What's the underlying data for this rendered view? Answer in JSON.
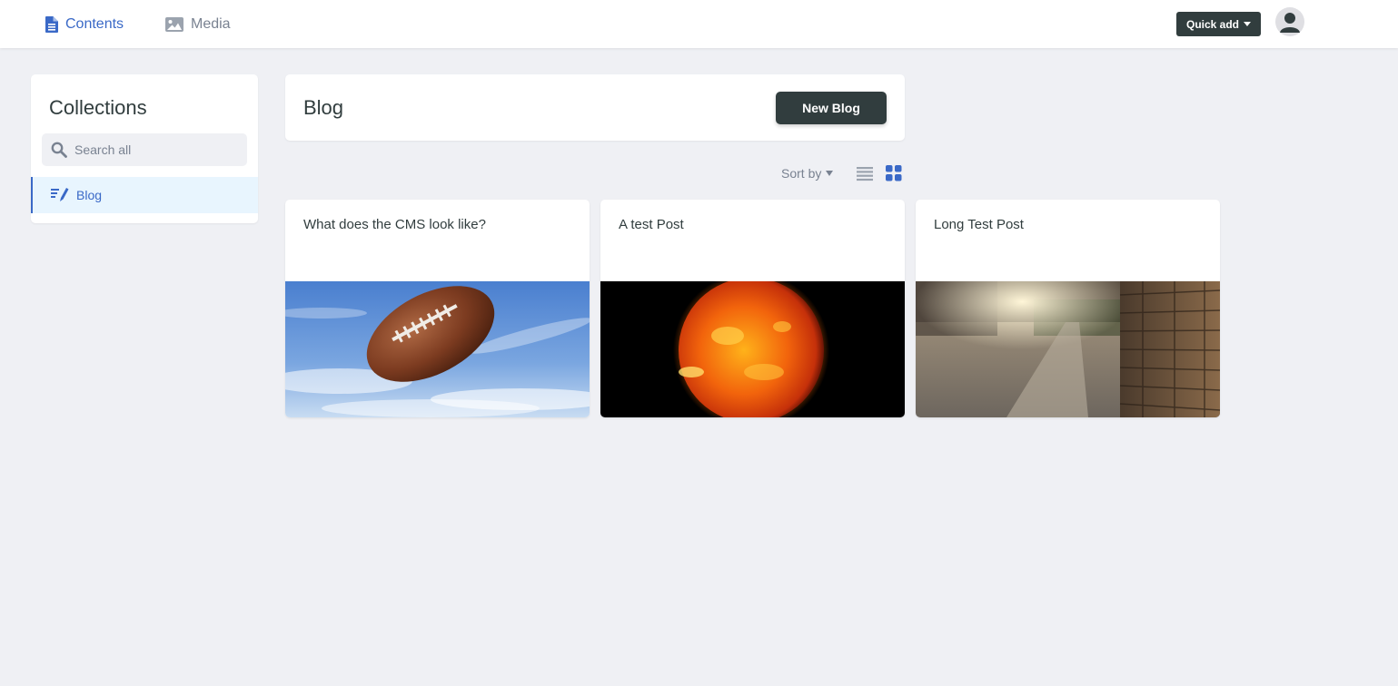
{
  "nav": {
    "contents_label": "Contents",
    "media_label": "Media",
    "quick_add_label": "Quick add"
  },
  "sidebar": {
    "title": "Collections",
    "search_placeholder": "Search all",
    "items": [
      {
        "label": "Blog",
        "icon": "pencil-list-icon",
        "active": true
      }
    ]
  },
  "collection": {
    "title": "Blog",
    "new_button_label": "New Blog",
    "sort_label": "Sort by",
    "view_mode": "grid"
  },
  "entries": [
    {
      "title": "What does the CMS look like?",
      "image": "american-football-in-sky"
    },
    {
      "title": "A test Post",
      "image": "sun-on-black"
    },
    {
      "title": "Long Test Post",
      "image": "sunlit-street-brick-wall"
    }
  ],
  "colors": {
    "accent": "#3a69c7",
    "dark": "#313d3e",
    "muted": "#798291",
    "background": "#eff0f4",
    "active_bg": "#e8f5fe"
  }
}
